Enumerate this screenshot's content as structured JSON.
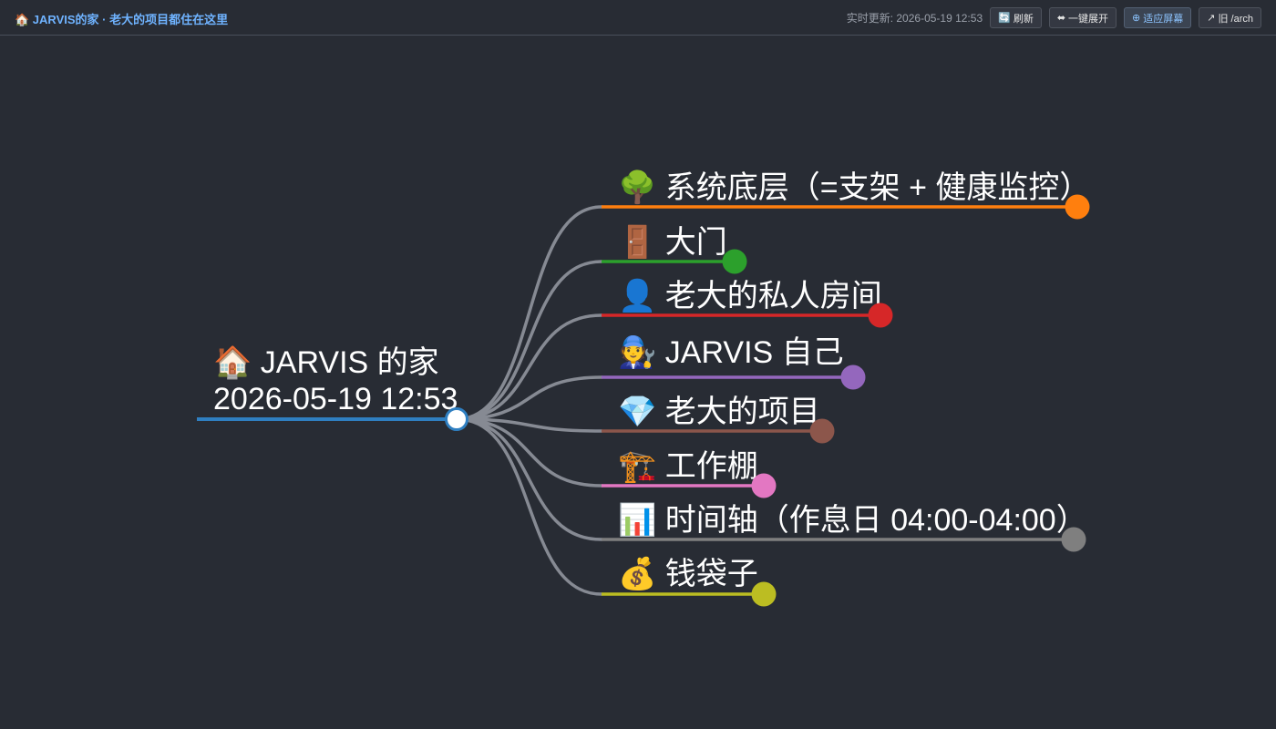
{
  "header": {
    "title": "🏠 JARVIS的家 · 老大的项目都住在这里",
    "status": "实时更新: 2026-05-19 12:53",
    "buttons": [
      {
        "icon": "🔄",
        "label": "刷新"
      },
      {
        "icon": "⬌",
        "label": "一键展开"
      },
      {
        "icon": "⊕",
        "label": "适应屏幕"
      },
      {
        "icon": "↗",
        "label": "旧 /arch"
      }
    ]
  },
  "mindmap": {
    "root": {
      "line1": "🏠 JARVIS 的家",
      "line2": "2026-05-19 12:53",
      "color": "#2f7fc1"
    },
    "children": [
      {
        "label": "🌳 系统底层（=支架 + 健康监控）",
        "color": "#ff7f0e"
      },
      {
        "label": "🚪 大门",
        "color": "#2ca02c"
      },
      {
        "label": "👤 老大的私人房间",
        "color": "#d62728"
      },
      {
        "label": "🧑‍🔧 JARVIS 自己",
        "color": "#9467bd"
      },
      {
        "label": "💎 老大的项目",
        "color": "#8c564b"
      },
      {
        "label": "🏗️ 工作棚",
        "color": "#e377c2"
      },
      {
        "label": "📊 时间轴（作息日 04:00-04:00）",
        "color": "#7f7f7f"
      },
      {
        "label": "💰 钱袋子",
        "color": "#bcbd22"
      }
    ]
  }
}
